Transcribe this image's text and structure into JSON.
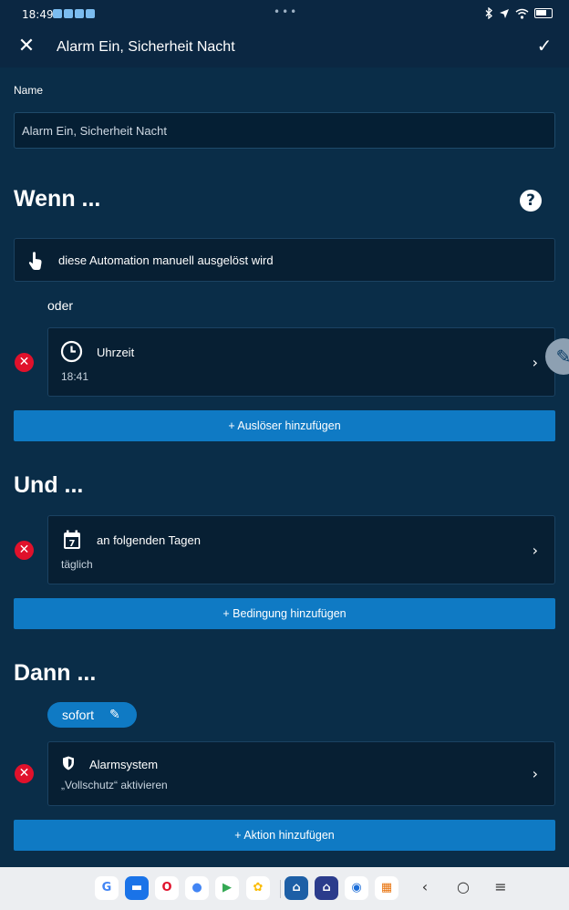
{
  "status_bar": {
    "time": "18:49",
    "notification_icons": [
      "bosch-notification-icon",
      "bosch-notification-icon",
      "bosch-notification-icon",
      "bosch-notification-icon"
    ],
    "center_dots": "•••",
    "system_icons": [
      "bluetooth-icon",
      "location-icon",
      "wifi-icon",
      "battery-icon"
    ]
  },
  "appbar": {
    "close_glyph": "✕",
    "title": "Alarm Ein, Sicherheit Nacht",
    "confirm_glyph": "✓"
  },
  "name_field": {
    "label": "Name",
    "value": "Alarm Ein, Sicherheit Nacht"
  },
  "when": {
    "heading": "Wenn ...",
    "help_glyph": "?",
    "manual_trigger": {
      "icon": "hand-pointer-icon",
      "text": "diese Automation manuell ausgelöst wird"
    },
    "or_label": "oder",
    "trigger": {
      "icon": "clock-icon",
      "title": "Uhrzeit",
      "subtitle": "18:41"
    },
    "add_button": "+ Auslöser hinzufügen"
  },
  "and": {
    "heading": "Und ...",
    "condition": {
      "icon": "calendar-icon",
      "calendar_day": "7",
      "title": "an folgenden Tagen",
      "subtitle": "täglich"
    },
    "add_button": "+ Bedingung hinzufügen"
  },
  "then": {
    "heading": "Dann ...",
    "timing_pill": "sofort",
    "action": {
      "icon": "shield-icon",
      "title": "Alarmsystem",
      "subtitle": "„Vollschutz“ aktivieren"
    },
    "add_button": "+ Aktion hinzufügen"
  },
  "nav_bar": {
    "apps": [
      "google-app-icon",
      "messages-app-icon",
      "opera-app-icon",
      "assistant-app-icon",
      "play-store-app-icon",
      "photos-app-icon",
      "bosch-smart-home-app-icon",
      "bosch-alarm-app-icon",
      "thunderbird-app-icon",
      "app-drawer-icon"
    ],
    "back": "‹",
    "home": "○",
    "menu": "≡"
  },
  "colors": {
    "background": "#0a2d48",
    "appbar": "#0b2742",
    "card": "#071f33",
    "accent_button": "#0f7ac4",
    "delete_red": "#e0112b"
  }
}
